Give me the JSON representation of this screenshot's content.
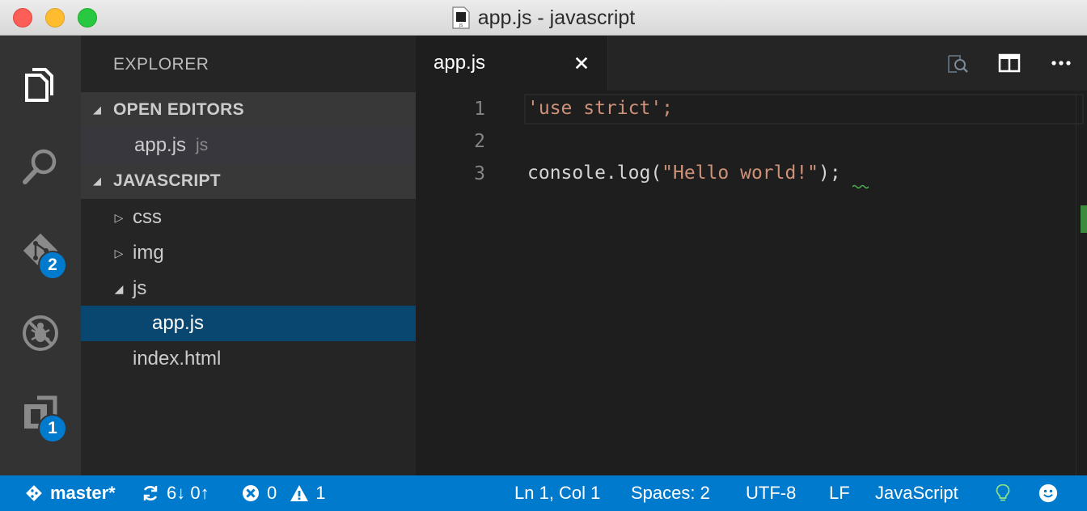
{
  "window": {
    "title": "app.js - javascript"
  },
  "activity_bar": {
    "scm_badge": "2",
    "extensions_badge": "1"
  },
  "sidebar": {
    "title": "EXPLORER",
    "open_editors": {
      "label": "OPEN EDITORS",
      "items": [
        {
          "name": "app.js",
          "hint": "js"
        }
      ]
    },
    "folder": {
      "label": "JAVASCRIPT",
      "tree": [
        {
          "name": "css"
        },
        {
          "name": "img"
        },
        {
          "name": "js"
        },
        {
          "name": "app.js"
        },
        {
          "name": "index.html"
        }
      ]
    }
  },
  "editor": {
    "tab": {
      "label": "app.js"
    },
    "lines": [
      {
        "number": "1",
        "text": "'use strict';"
      },
      {
        "number": "2",
        "text": ""
      },
      {
        "number": "3",
        "text": "console.log(\"Hello world!\");"
      }
    ]
  },
  "status_bar": {
    "branch": "master*",
    "sync": "6↓ 0↑",
    "errors": "0",
    "warnings": "1",
    "position": "Ln 1, Col 1",
    "indentation": "Spaces: 2",
    "encoding": "UTF-8",
    "eol": "LF",
    "language": "JavaScript"
  },
  "colors": {
    "status_bar": "#007acc",
    "selection": "#094771",
    "string": "#ce9178",
    "badge": "#007acc"
  }
}
